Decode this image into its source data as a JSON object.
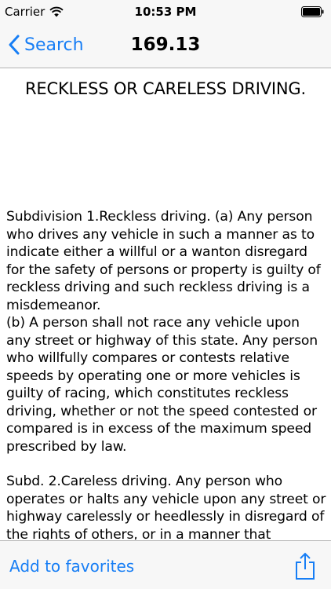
{
  "status_bar": {
    "carrier": "Carrier",
    "time": "10:53 PM"
  },
  "nav": {
    "back_label": "Search",
    "title": "169.13"
  },
  "content": {
    "section_title": "RECKLESS OR CARELESS DRIVING.",
    "paragraphs": [
      "Subdivision 1.Reckless driving. (a) Any person who drives any vehicle in such a manner as to indicate either a willful or a wanton disregard for the safety of persons or property is guilty of reckless driving and such reckless driving is a misdemeanor.",
      "(b) A person shall not race any vehicle upon any street or highway of this state. Any person who willfully compares or contests relative speeds by operating one or more vehicles is guilty of racing, which constitutes reckless driving, whether or not the speed contested or compared is in excess of the maximum speed prescribed by law.",
      "Subd. 2.Careless driving. Any person who operates or halts any vehicle upon any street or highway carelessly or heedlessly in disregard of the rights of others, or in a manner that"
    ]
  },
  "toolbar": {
    "favorites_label": "Add to favorites",
    "share_icon": "share-icon"
  },
  "colors": {
    "accent": "#177ef5",
    "bar_background": "#f7f7f7"
  }
}
